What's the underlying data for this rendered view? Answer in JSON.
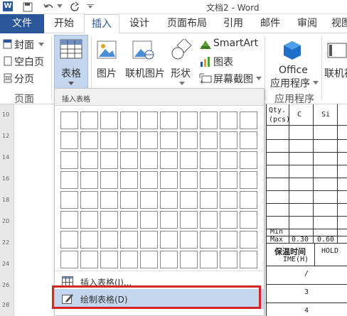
{
  "title_bar": {
    "doc_title": "文档2 - Word",
    "app_icon": "W"
  },
  "tabs": [
    {
      "label": "文件",
      "kind": "file"
    },
    {
      "label": "开始"
    },
    {
      "label": "插入",
      "active": true
    },
    {
      "label": "设计"
    },
    {
      "label": "页面布局"
    },
    {
      "label": "引用"
    },
    {
      "label": "邮件"
    },
    {
      "label": "审阅"
    },
    {
      "label": "视图"
    }
  ],
  "ribbon": {
    "pages_group": {
      "cover": "封面",
      "blank": "空白页",
      "break": "分页",
      "label": "页面"
    },
    "table_btn": "表格",
    "picture_btn": "图片",
    "online_picture_btn": "联机图片",
    "shapes_btn": "形状",
    "smartart_btn": "SmartArt",
    "chart_btn": "图表",
    "screenshot_btn": "屏幕截图",
    "office_btn_line1": "Office",
    "office_btn_line2": "应用程序",
    "apps_group_label": "应用程序",
    "online_video_btn": "联机视频"
  },
  "dropdown": {
    "header": "插入表格",
    "insert_table": "插入表格(I)...",
    "draw_table": "绘制表格(D)"
  },
  "doc_table": {
    "qty": "Qty.",
    "pcs": "(pcs)",
    "c": "C",
    "si": "Si",
    "min": "Min",
    "max": "Max",
    "max_c": "0.30",
    "max_si": "0.60",
    "hold_time": "保温时间",
    "hold": "HOLD",
    "time_h": "IME(H)",
    "slash": "/",
    "three": "3",
    "four": "4"
  },
  "ruler_marks": [
    "10",
    "12",
    "14",
    "16",
    "18",
    "20",
    "22",
    "24",
    "26",
    "28"
  ],
  "colors": {
    "brand": "#2b579a",
    "highlight": "#c5d7ee",
    "callout": "#d32626"
  }
}
